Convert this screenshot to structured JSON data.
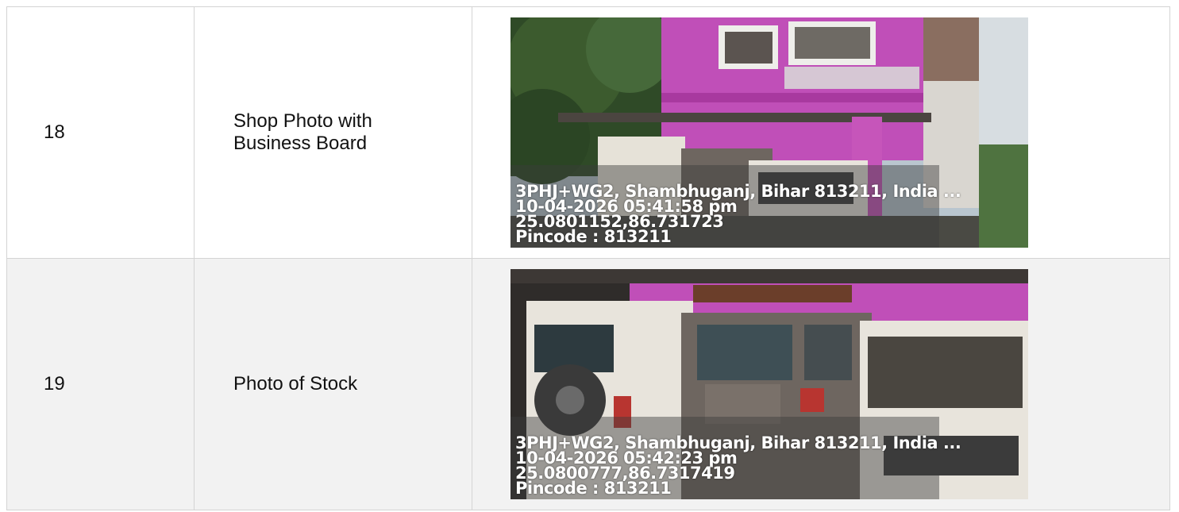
{
  "rows": [
    {
      "number": "18",
      "label": "Shop Photo with Business Board",
      "photo": {
        "description_icon": "photo-building-vehicles",
        "stamp": {
          "address": "3PHJ+WG2, Shambhuganj, Bihar 813211, India ...",
          "datetime": "10-04-2026 05:41:58 pm",
          "coords": "25.0801152,86.731723",
          "pincode": "Pincode : 813211"
        }
      }
    },
    {
      "number": "19",
      "label": "Photo of Stock",
      "photo": {
        "description_icon": "photo-parked-vehicles",
        "stamp": {
          "address": "3PHJ+WG2, Shambhuganj, Bihar 813211, India ...",
          "datetime": "10-04-2026 05:42:23 pm",
          "coords": "25.0800777,86.7317419",
          "pincode": "Pincode : 813211"
        }
      }
    }
  ],
  "colors": {
    "border": "#d4d4d4",
    "alt_row": "#f2f2f2",
    "building_pink": "#c04fb8",
    "vehicle_white": "#e8e4dc",
    "vehicle_grey": "#6e6660"
  }
}
